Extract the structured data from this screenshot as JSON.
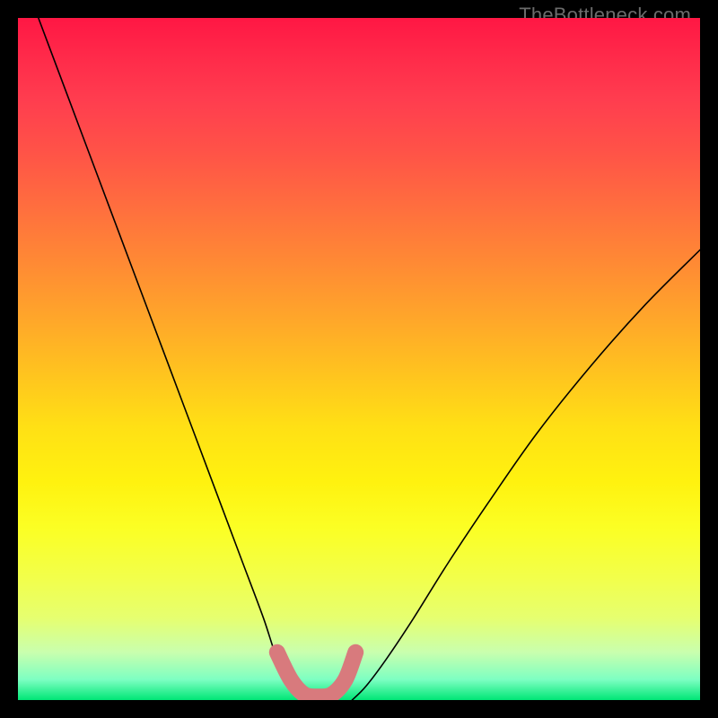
{
  "watermark": "TheBottleneck.com",
  "colors": {
    "frame_bg": "#000000",
    "curve_stroke": "#000000",
    "optimal_band": "#d87a7d",
    "gradient_top": "#ff1744",
    "gradient_mid": "#ffe015",
    "gradient_bottom": "#00e676"
  },
  "chart_data": {
    "type": "line",
    "title": "",
    "xlabel": "",
    "ylabel": "",
    "xlim": [
      0,
      100
    ],
    "ylim": [
      0,
      100
    ],
    "series": [
      {
        "name": "left-curve",
        "x": [
          3,
          6,
          9,
          12,
          15,
          18,
          21,
          24,
          27,
          30,
          33,
          36,
          38,
          40,
          41.5
        ],
        "y": [
          100,
          92,
          84,
          76,
          68,
          60,
          52,
          44,
          36,
          28,
          20,
          12,
          6,
          2,
          0
        ]
      },
      {
        "name": "right-curve",
        "x": [
          49,
          51,
          54,
          58,
          63,
          69,
          76,
          84,
          92,
          100
        ],
        "y": [
          0,
          2,
          6,
          12,
          20,
          29,
          39,
          49,
          58,
          66
        ]
      },
      {
        "name": "optimal-band",
        "x": [
          38,
          40,
          42,
          44,
          46,
          48,
          49.5
        ],
        "y": [
          7,
          3,
          0.8,
          0.5,
          0.8,
          3,
          7
        ]
      }
    ],
    "annotations": []
  }
}
